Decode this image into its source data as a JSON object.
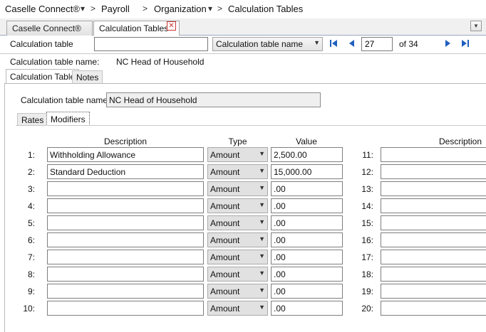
{
  "breadcrumb": {
    "items": [
      "Caselle Connect®",
      "Payroll",
      "Organization",
      "Calculation Tables"
    ],
    "separator": ">",
    "dropdown_glyph": "▾"
  },
  "tabs": [
    {
      "label": "Caselle Connect®",
      "active": false
    },
    {
      "label": "Calculation Tables",
      "active": true
    }
  ],
  "tab_close_icon": "close-icon",
  "tab_menu_icon": "chevron-down-icon",
  "toolbar": {
    "calc_table_label": "Calculation table",
    "calc_table_value": "",
    "search_by_value": "Calculation table name",
    "record_number": "27",
    "record_total": "of 34",
    "nav_icons": [
      "first-record-icon",
      "previous-record-icon",
      "next-record-icon",
      "last-record-icon"
    ]
  },
  "info": {
    "name_label": "Calculation table name:",
    "name_value": "NC Head of Household"
  },
  "subtabs": [
    {
      "label": "Calculation Table",
      "active": true
    },
    {
      "label": "Notes",
      "active": false
    }
  ],
  "form": {
    "name_label": "Calculation table name:",
    "name_value": "NC Head of Household"
  },
  "modifier_tabs": [
    {
      "label": "Rates",
      "active": false
    },
    {
      "label": "Modifiers",
      "active": true
    }
  ],
  "grid": {
    "headers": {
      "description": "Description",
      "type": "Type",
      "value": "Value",
      "description_right": "Description"
    },
    "left_rows": [
      {
        "num": "1:",
        "description": "Withholding Allowance",
        "type": "Amount",
        "value": "2,500.00"
      },
      {
        "num": "2:",
        "description": "Standard Deduction",
        "type": "Amount",
        "value": "15,000.00"
      },
      {
        "num": "3:",
        "description": "",
        "type": "Amount",
        "value": ".00"
      },
      {
        "num": "4:",
        "description": "",
        "type": "Amount",
        "value": ".00"
      },
      {
        "num": "5:",
        "description": "",
        "type": "Amount",
        "value": ".00"
      },
      {
        "num": "6:",
        "description": "",
        "type": "Amount",
        "value": ".00"
      },
      {
        "num": "7:",
        "description": "",
        "type": "Amount",
        "value": ".00"
      },
      {
        "num": "8:",
        "description": "",
        "type": "Amount",
        "value": ".00"
      },
      {
        "num": "9:",
        "description": "",
        "type": "Amount",
        "value": ".00"
      },
      {
        "num": "10:",
        "description": "",
        "type": "Amount",
        "value": ".00"
      }
    ],
    "right_rows": [
      {
        "num": "11:",
        "description": ""
      },
      {
        "num": "12:",
        "description": ""
      },
      {
        "num": "13:",
        "description": ""
      },
      {
        "num": "14:",
        "description": ""
      },
      {
        "num": "15:",
        "description": ""
      },
      {
        "num": "16:",
        "description": ""
      },
      {
        "num": "17:",
        "description": ""
      },
      {
        "num": "18:",
        "description": ""
      },
      {
        "num": "19:",
        "description": ""
      },
      {
        "num": "20:",
        "description": ""
      }
    ]
  },
  "colors": {
    "nav_blue": "#1f5fbf",
    "close_red": "#c83232"
  }
}
